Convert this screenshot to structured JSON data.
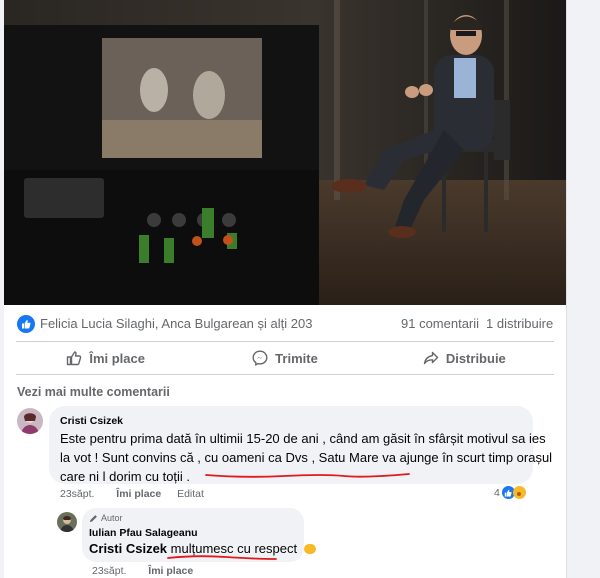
{
  "post": {
    "reactions_text": "Felicia Lucia Silaghi, Anca Bulgarean și alți 203",
    "comments_count": "91 comentarii",
    "shares_count": "1 distribuire"
  },
  "actions": {
    "like_label": "Îmi place",
    "send_label": "Trimite",
    "share_label": "Distribuie"
  },
  "comments_section": {
    "more_label": "Vezi mai multe comentarii"
  },
  "comment1": {
    "author": "Cristi Csizek",
    "line1": "Este pentru prima dată în ultimii 15-20 de ani , când am găsit în sfârșit motivul sa ies",
    "line2": "la vot ! Sunt convins că , cu oameni ca Dvs , Satu Mare va ajunge în scurt timp orașul",
    "line3": "care ni l dorim cu toții .",
    "time": "23săpt.",
    "like": "Îmi place",
    "edited": "Editat",
    "reaction_count": "4"
  },
  "reply1": {
    "badge": "Autor",
    "author": "Iulian Pfau Salageanu",
    "mention": "Cristi Csizek",
    "text": "mulțumesc cu respect",
    "time": "23săpt.",
    "like": "Îmi place"
  },
  "colors": {
    "facebook_blue": "#1877f2",
    "annotation_red": "#e0191f",
    "bubble_bg": "#f0f2f5",
    "secondary_text": "#65676b"
  }
}
